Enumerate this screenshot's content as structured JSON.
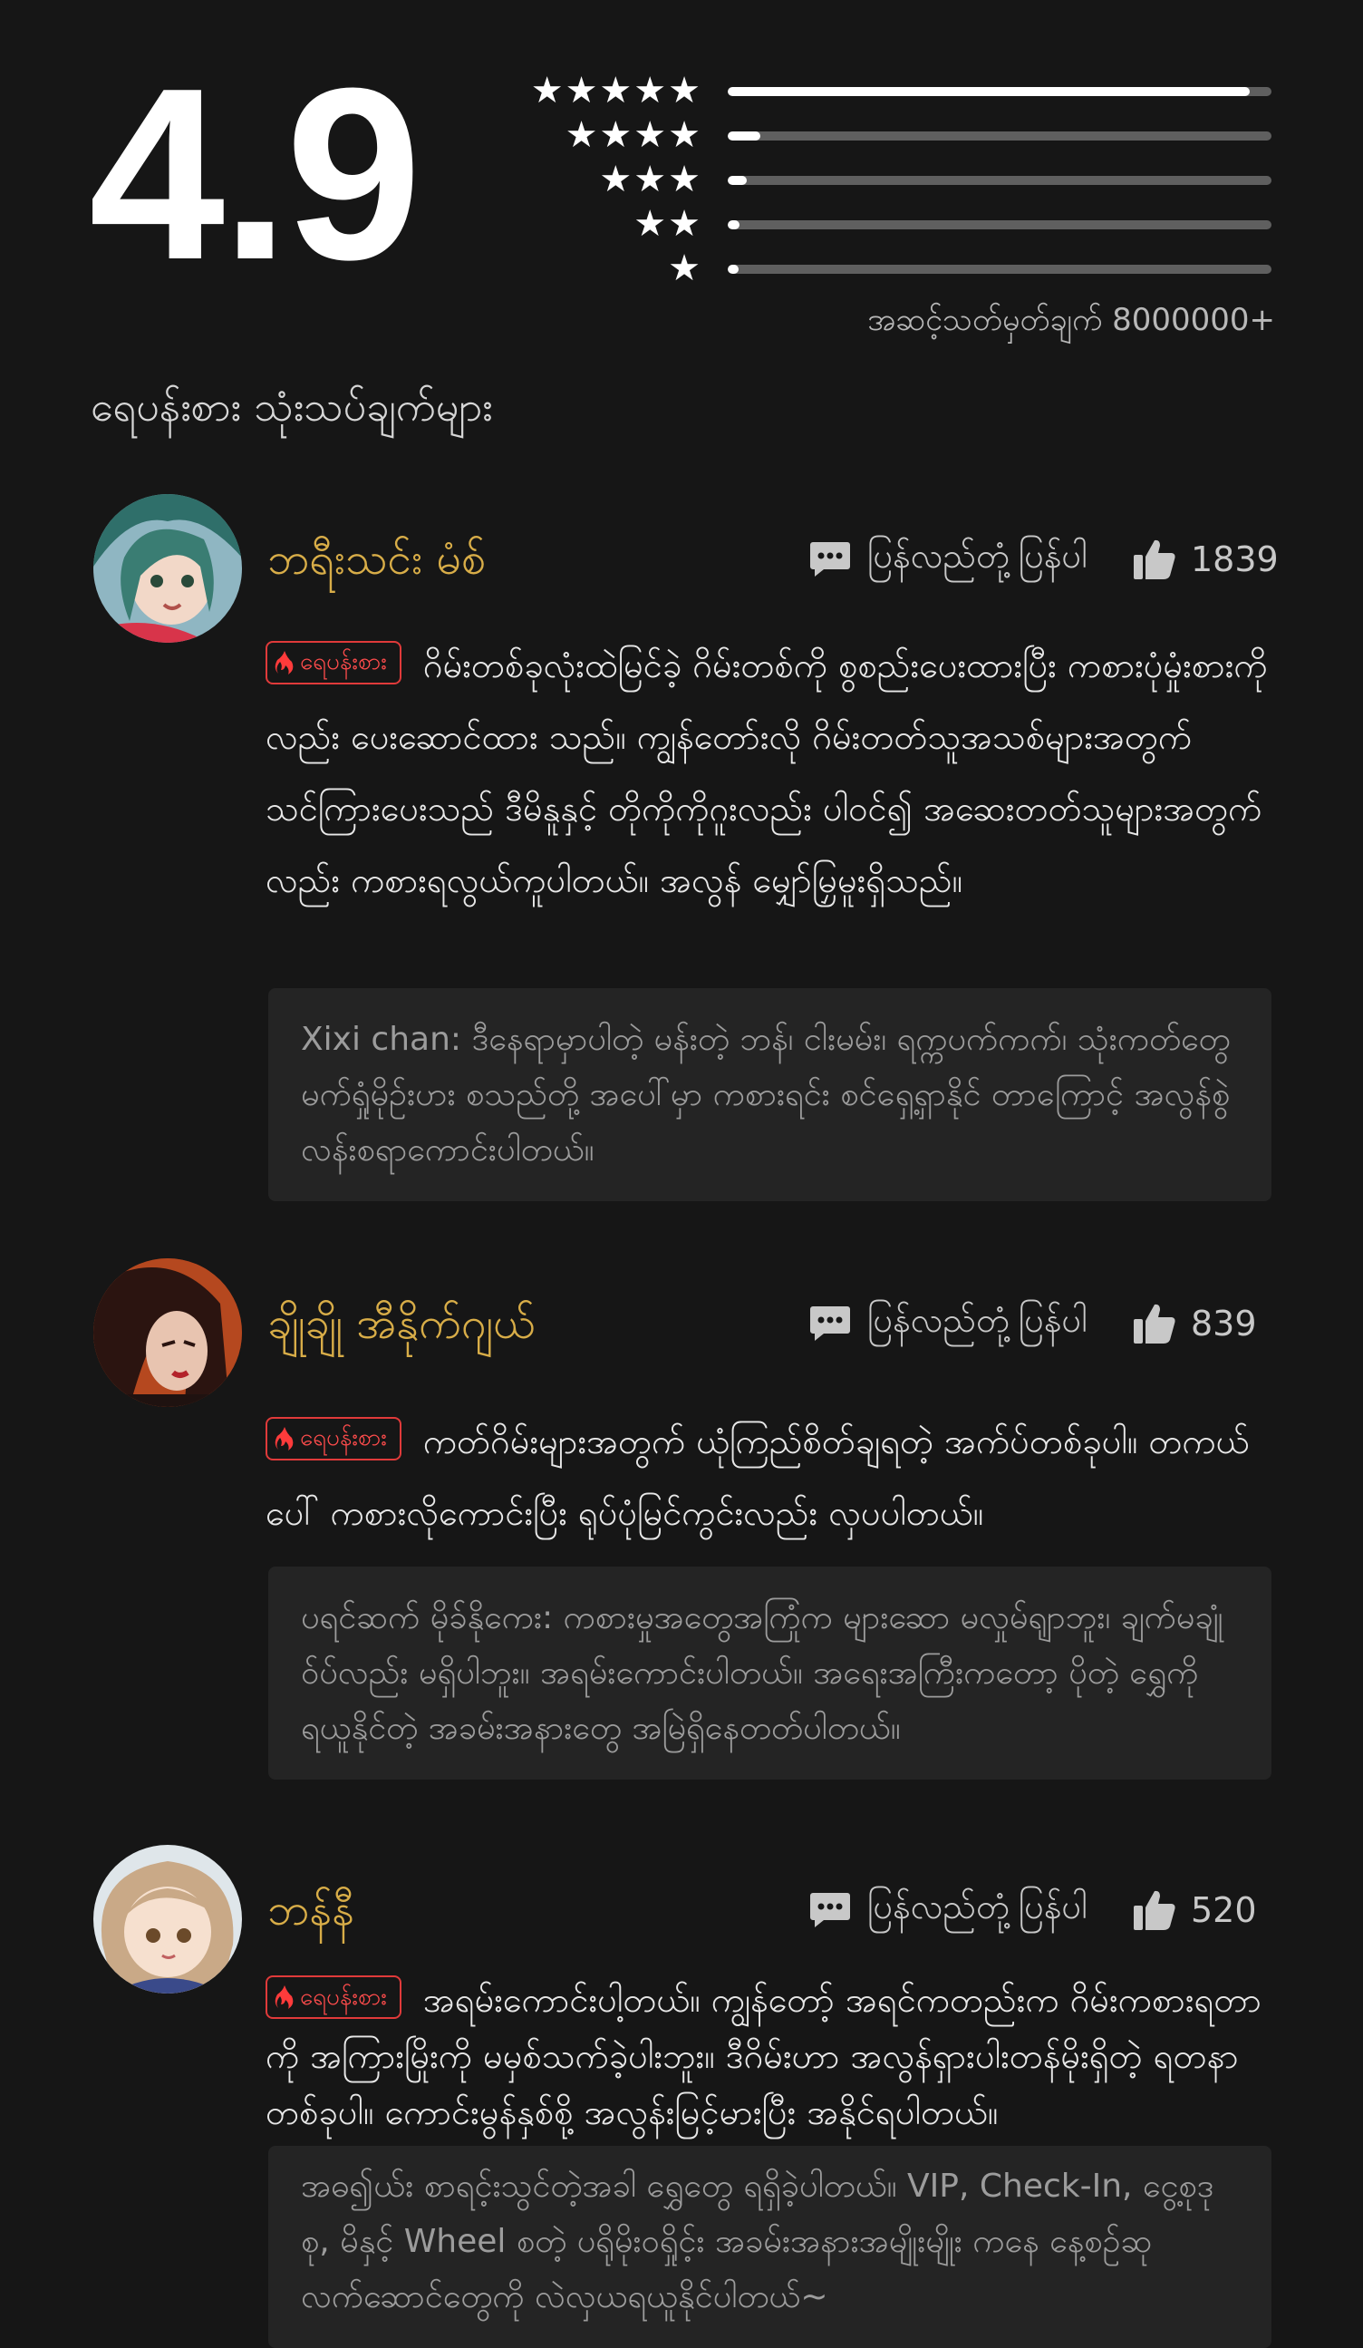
{
  "rating": {
    "score": "4.9",
    "distribution": [
      {
        "stars": "★★★★★",
        "fraction": 0.96
      },
      {
        "stars": "★★★★",
        "fraction": 0.06
      },
      {
        "stars": "★★★",
        "fraction": 0.035
      },
      {
        "stars": "★★",
        "fraction": 0.022
      },
      {
        "stars": "★",
        "fraction": 0.02
      }
    ],
    "count_text": "အဆင့်သတ်မှတ်ချက် 8000000+"
  },
  "section_title": "ရေပန်းစား သုံးသပ်ချက်များ",
  "reviews": [
    {
      "name": "ဘရီးသင်း မံစ်",
      "reply_label": "ပြန်လည်တုံ့ပြန်ပါ",
      "likes": "1839",
      "badge": "ရေပန်းစား",
      "text": "ဂိမ်းတစ်ခုလုံးထဲမြင်ခဲ့ ဂိမ်းတစ်ကို စွစည်းပေးထားပြီး ကစားပုံမှုံးစားကိုလည်း ပေးဆောင်ထား သည်။ ကျွန်တော်းလို ဂိမ်းတတ်သူအသစ်များအတွက် သင်ကြားပေးသည် ဒီမိနူနှင့် တိုကိုကိုဂူးလည်း ပါဝင်၍ အဆေးတတ်သူများအတွက်လည်း ကစားရလွယ်ကူပါတယ်။ အလွန် မျှော်မြှမူးရှိသည်။",
      "dev_reply": "Xixi chan: ဒီနေရာမှာပါတဲ့ မန်းတဲ့ ဘန်၊ ငါးမမ်း၊ ရက္ကပက်ကက်၊ သုံးကတ်တွေ မက်ရှုံမိုဉ်းပား စသည်တို့ အပေါ်မှာ ကစားရင်း စင်ရှေ့ရှာနိုင် တာကြောင့် အလွန်စွဲလန်းစရာကောင်းပါတယ်။"
    },
    {
      "name": "ချိုချို အီနိုက်ဂျယ်",
      "reply_label": "ပြန်လည်တုံ့ပြန်ပါ",
      "likes": "839",
      "badge": "ရေပန်းစား",
      "text": "ကတ်ဂိမ်းများအတွက် ယုံကြည်စိတ်ချရတဲ့ အက်ပ်တစ်ခုပါ။ တကယ်ပေါ် ကစားလိုကောင်းပြီး ရုပ်ပုံမြင်ကွင်းလည်း လှပပါတယ်။",
      "dev_reply": "ပရင်ဆက် မိုခ်နိုကေး: ကစားမှုအတွေအကြုံက များဆော မလှုမ်ရျာဘူး၊ ချက်မချုံဝ်ပ်လည်း မရှိပါဘူး။ အရမ်းကောင်းပါတယ်။ အရေးအကြီးကတော့ ပိုတဲ့ ရွှေကို ရယူနိုင်တဲ့ အခမ်းအနားတွေ အမြဲရှိနေတတ်ပါတယ်။"
    },
    {
      "name": "ဘန်နီ",
      "reply_label": "ပြန်လည်တုံ့ပြန်ပါ",
      "likes": "520",
      "badge": "ရေပန်းစား",
      "text": "အရမ်းကောင်းပါ့တယ်။ ကျွန်တော့် အရင်ကတည်းက ဂိမ်းကစားရတာကို အကြားမြိုးကို မမှစ်သက်ခဲ့ပါးဘူး။ ဒီဂိမ်းဟာ အလွန်ရှားပါးတန်မိုးရှိတဲ့ ရတနာတစ်ခုပါ။ ကောင်းမွန်နှစ်စို့ အလွန်းမြင့်မားပြီး အနိုင်ရပါတယ်။",
      "dev_reply": "အဓ၍ယ်း စာရင့်းသွင်တဲ့အခါ ရွှေတွေ ရရှိခဲ့ပါတယ်။ VIP, Check-In, ငွေ့စုဒုစု, မိနှင့် Wheel စတဲ့ ပရိုမိုးဝရှိုင့်း အခမ်းအနားအမျိုးမျိုး ကနေ နေ့စဉ်ဆုလက်ဆောင်တွေကို လဲလှယရယူနိုင်ပါတယ်~"
    }
  ]
}
